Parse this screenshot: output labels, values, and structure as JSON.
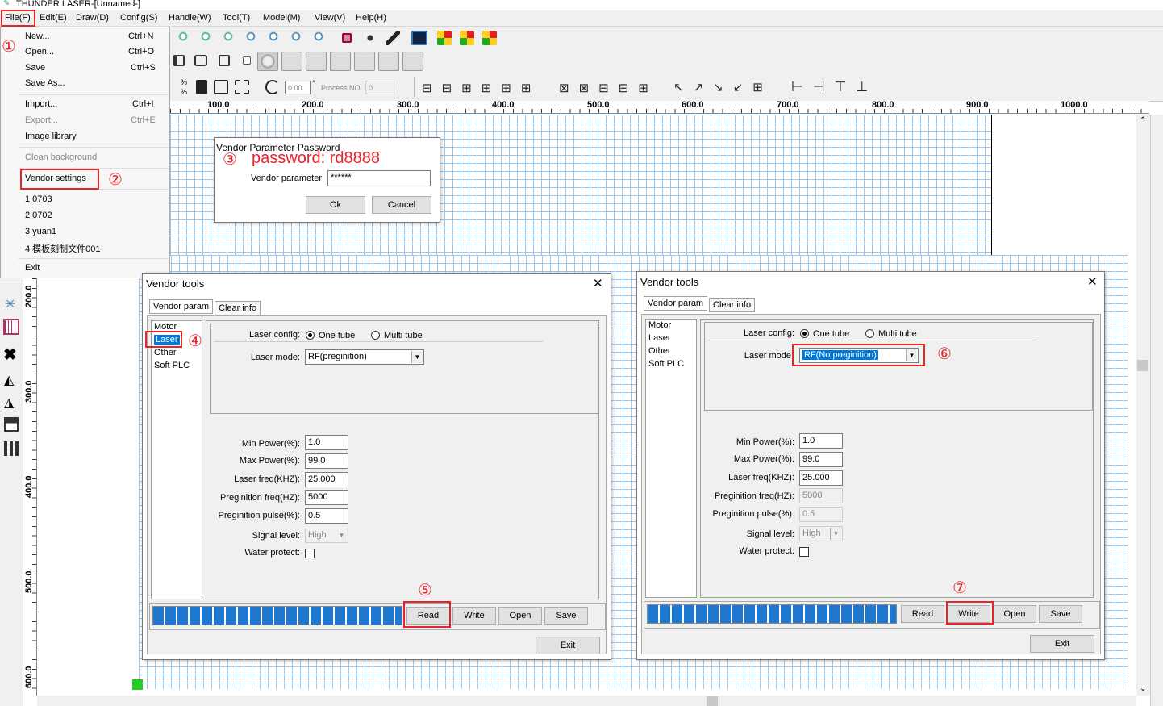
{
  "app": {
    "title": "THUNDER LASER-[Unnamed-]"
  },
  "menu": {
    "file": "File(F)",
    "edit": "Edit(E)",
    "draw": "Draw(D)",
    "config": "Config(S)",
    "handle": "Handle(W)",
    "tool": "Tool(T)",
    "model": "Model(M)",
    "view": "View(V)",
    "help": "Help(H)"
  },
  "file_menu": {
    "new": "New...",
    "new_sc": "Ctrl+N",
    "open": "Open...",
    "open_sc": "Ctrl+O",
    "save": "Save",
    "save_sc": "Ctrl+S",
    "save_as": "Save As...",
    "import": "Import...",
    "import_sc": "Ctrl+I",
    "export": "Export...",
    "export_sc": "Ctrl+E",
    "image_library": "Image library",
    "clean_background": "Clean background",
    "vendor_settings": "Vendor settings",
    "recent1": "1 0703",
    "recent2": "2 0702",
    "recent3": "3 yuan1",
    "recent4": "4 模板刻制文件001",
    "exit": "Exit"
  },
  "toolbar3": {
    "angle": "0.00",
    "process_no_label": "Process NO:",
    "process_no": "0",
    "pct1": "%",
    "pct2": "%"
  },
  "ruler_h": [
    "100.0",
    "200.0",
    "300.0",
    "400.0",
    "500.0",
    "600.0",
    "700.0",
    "800.0",
    "900.0",
    "1000.0"
  ],
  "ruler_v": [
    "200.0",
    "300.0",
    "400.0",
    "500.0",
    "600.0"
  ],
  "password_dialog": {
    "title": "Vendor Parameter Password",
    "annotation": "password: rd8888",
    "label": "Vendor parameter",
    "value": "******",
    "ok": "Ok",
    "cancel": "Cancel"
  },
  "steps": {
    "s1": "①",
    "s2": "②",
    "s3": "③",
    "s4": "④",
    "s5": "⑤",
    "s6": "⑥",
    "s7": "⑦"
  },
  "vendor_left": {
    "title": "Vendor tools",
    "close": "✕",
    "tab1": "Vendor param",
    "tab2": "Clear info",
    "list": [
      "Motor",
      "Laser",
      "Other",
      "Soft PLC"
    ],
    "laser_config_label": "Laser config:",
    "one_tube": "One tube",
    "multi_tube": "Multi tube",
    "laser_mode_label": "Laser mode:",
    "laser_mode": "RF(preginition)",
    "min_power_label": "Min Power(%):",
    "min_power": "1.0",
    "max_power_label": "Max Power(%):",
    "max_power": "99.0",
    "laser_freq_label": "Laser freq(KHZ):",
    "laser_freq": "25.000",
    "preg_freq_label": "Preginition freq(HZ):",
    "preg_freq": "5000",
    "preg_pulse_label": "Preginition pulse(%):",
    "preg_pulse": "0.5",
    "signal_label": "Signal level:",
    "signal": "High",
    "water_label": "Water protect:",
    "read": "Read",
    "write": "Write",
    "open": "Open",
    "save": "Save",
    "exit": "Exit"
  },
  "vendor_right": {
    "title": "Vendor tools",
    "close": "✕",
    "tab1": "Vendor param",
    "tab2": "Clear info",
    "list": [
      "Motor",
      "Laser",
      "Other",
      "Soft PLC"
    ],
    "laser_config_label": "Laser config:",
    "one_tube": "One tube",
    "multi_tube": "Multi tube",
    "laser_mode_label": "Laser mode",
    "laser_mode": "RF(No preginition)",
    "min_power_label": "Min Power(%):",
    "min_power": "1.0",
    "max_power_label": "Max Power(%):",
    "max_power": "99.0",
    "laser_freq_label": "Laser freq(KHZ):",
    "laser_freq": "25.000",
    "preg_freq_label": "Preginition freq(HZ):",
    "preg_freq": "5000",
    "preg_pulse_label": "Preginition pulse(%):",
    "preg_pulse": "0.5",
    "signal_label": "Signal level:",
    "signal": "High",
    "water_label": "Water protect:",
    "read": "Read",
    "write": "Write",
    "open": "Open",
    "save": "Save",
    "exit": "Exit"
  },
  "colors": {
    "accent": "#e8232a",
    "grid": "#9cc7ec",
    "progress": "#1e78d0",
    "selection": "#0078d7"
  }
}
